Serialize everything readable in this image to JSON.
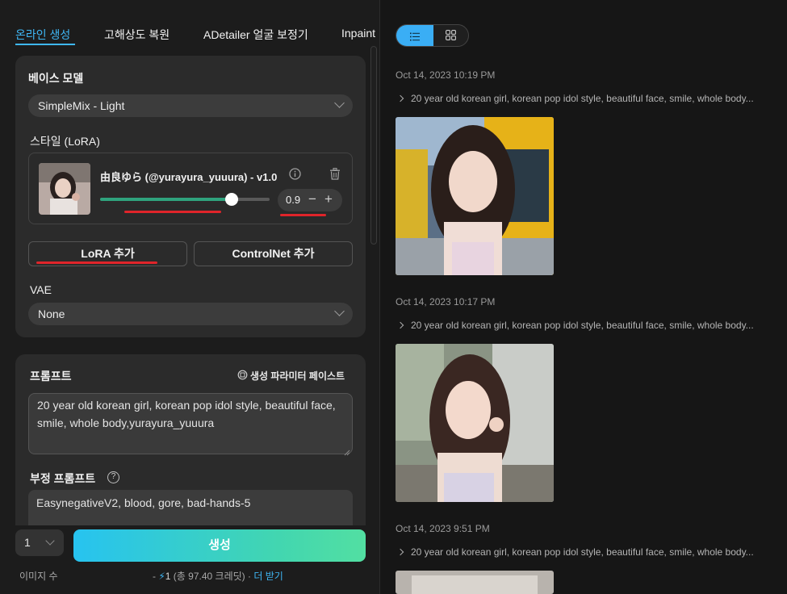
{
  "tabs": [
    "온라인 생성",
    "고해상도 복원",
    "ADetailer 얼굴 보정기",
    "Inpaint"
  ],
  "base_model": {
    "label": "베이스 모델",
    "value": "SimpleMix - Light"
  },
  "style": {
    "label": "스타일 (LoRA)",
    "lora_name": "由良ゆら (@yurayura_yuuura) - v1.0",
    "weight": "0.9",
    "slider_fraction": 0.9,
    "minus": "−",
    "plus": "+"
  },
  "buttons": {
    "add_lora": "LoRA 추가",
    "add_controlnet": "ControlNet 추가"
  },
  "vae": {
    "label": "VAE",
    "value": "None"
  },
  "prompt": {
    "label": "프롬프트",
    "paste_params": "생성 파라미터 페이스트",
    "value": "20 year old korean girl, korean pop idol style, beautiful face, smile, whole body,yurayura_yuuura"
  },
  "negative_prompt": {
    "label": "부정 프롬프트",
    "help": "?",
    "value": "EasynegativeV2, blood, gore, bad-hands-5"
  },
  "footer": {
    "count_value": "1",
    "count_label": "이미지 수",
    "generate": "생성",
    "credit_prefix": "- ",
    "credit_amount": "1",
    "credit_detail": " (총 97.40 크레딧) · ",
    "credit_link": "더 받기"
  },
  "history": [
    {
      "timestamp": "Oct 14, 2023 10:19 PM",
      "prompt": "20 year old korean girl, korean pop idol style, beautiful face, smile, whole body..."
    },
    {
      "timestamp": "Oct 14, 2023 10:17 PM",
      "prompt": "20 year old korean girl, korean pop idol style, beautiful face, smile, whole body..."
    },
    {
      "timestamp": "Oct 14, 2023 9:51 PM",
      "prompt": "20 year old korean girl, korean pop idol style, beautiful face, smile, whole body..."
    }
  ],
  "colors": {
    "accent": "#3fb7f5",
    "slider": "#2fa37d",
    "annotation": "#e0242a",
    "generate_start": "#27c3f0",
    "generate_end": "#52dfa2"
  }
}
